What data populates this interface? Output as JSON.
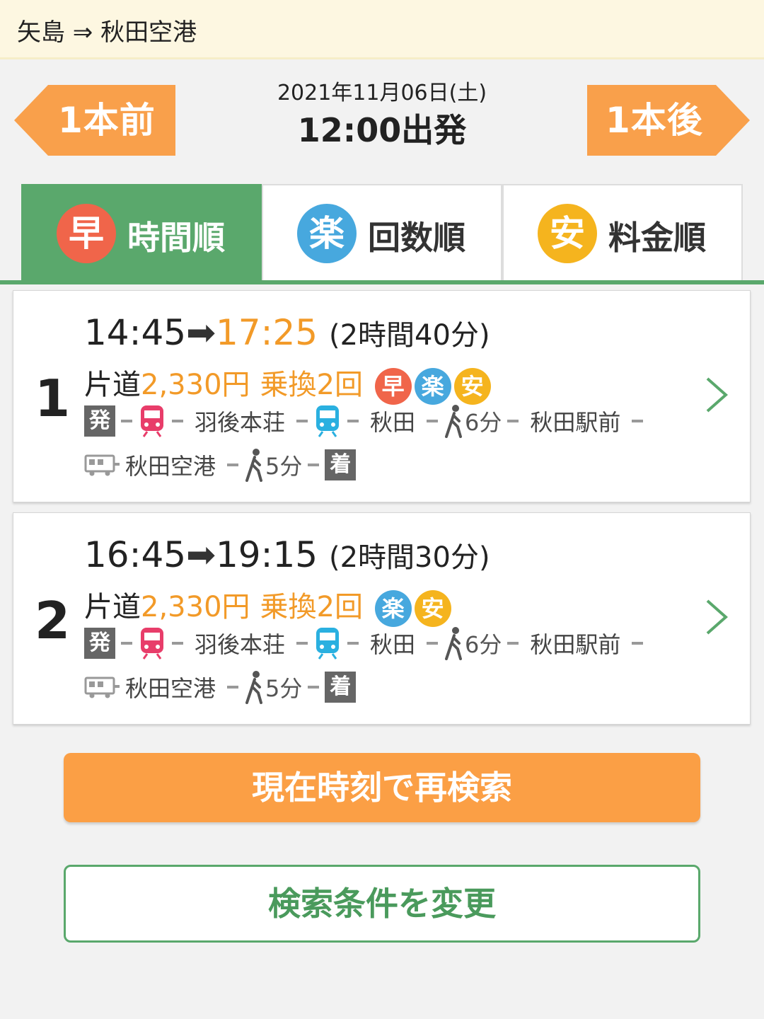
{
  "header": {
    "route": "矢島 ⇒ 秋田空港"
  },
  "nav": {
    "prev_label": "1本前",
    "next_label": "1本後",
    "date": "2021年11月06日(土)",
    "departure": "12:00出発",
    "accent_color": "#f9a04b"
  },
  "tabs": [
    {
      "badge": "早",
      "label": "時間順",
      "active": true
    },
    {
      "badge": "楽",
      "label": "回数順",
      "active": false
    },
    {
      "badge": "安",
      "label": "料金順",
      "active": false
    }
  ],
  "results": [
    {
      "rank": "1",
      "depart": "14:45",
      "arrive": "17:25",
      "duration": "(2時間40分)",
      "fare_prefix": "片道",
      "fare": "2,330円",
      "transfers": "乗換2回",
      "badges": [
        "早",
        "楽",
        "安"
      ],
      "segments": {
        "start": "発",
        "station1": "羽後本荘",
        "station2": "秋田",
        "walk1": "6分",
        "station3": "秋田駅前",
        "station4": "秋田空港",
        "walk2": "5分",
        "end": "着"
      }
    },
    {
      "rank": "2",
      "depart": "16:45",
      "arrive": "19:15",
      "duration": "(2時間30分)",
      "fare_prefix": "片道",
      "fare": "2,330円",
      "transfers": "乗換2回",
      "badges": [
        "楽",
        "安"
      ],
      "segments": {
        "start": "発",
        "station1": "羽後本荘",
        "station2": "秋田",
        "walk1": "6分",
        "station3": "秋田駅前",
        "station4": "秋田空港",
        "walk2": "5分",
        "end": "着"
      }
    }
  ],
  "actions": {
    "research_label": "現在時刻で再検索",
    "change_label": "検索条件を変更"
  },
  "colors": {
    "green": "#5aa86c",
    "orange": "#f29a28",
    "fast": "#f0654a",
    "easy": "#47a8de",
    "cheap": "#f5b41e"
  }
}
